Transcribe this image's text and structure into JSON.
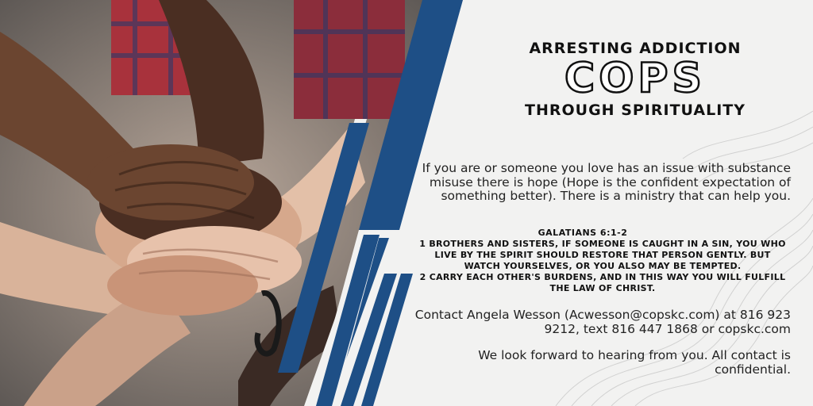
{
  "header": {
    "line1": "ARRESTING ADDICTION",
    "brand": "COPS",
    "line3": "THROUGH SPIRITUALITY"
  },
  "body": {
    "intro": "If you are or someone you love has an issue with substance misuse there is hope (Hope is the confident expectation of something better). There is a ministry that can help you.",
    "verse_ref": "GALATIANS 6:1-2",
    "verse_1": "1 Brothers and sisters, if someone is caught in a sin, you who live by the Spirit should restore that person gently. But watch yourselves, or you also may be tempted.",
    "verse_2": "2 Carry each other's burdens, and in this way you will fulfill the law of Christ.",
    "contact": "Contact Angela Wesson (Acwesson@copskc.com) at 816 923 9212, text 816 447 1868 or copskc.com",
    "closing": "We look forward to hearing from you. All contact is confidential."
  },
  "colors": {
    "accent_blue": "#1e4f86",
    "background": "#f2f2f1",
    "text": "#111111"
  }
}
